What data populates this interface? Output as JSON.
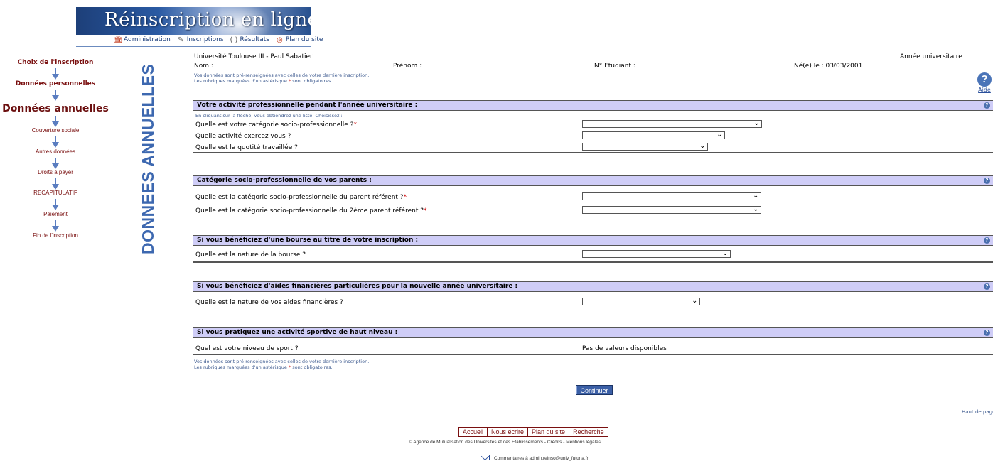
{
  "banner": {
    "title": "Réinscription en ligne"
  },
  "topnav": {
    "items": [
      {
        "label": "Administration",
        "icon": "bank-icon"
      },
      {
        "label": "Inscriptions",
        "icon": "pen-icon"
      },
      {
        "label": "Résultats",
        "icon": "brackets-icon"
      },
      {
        "label": "Plan du site",
        "icon": "sitemap-icon"
      }
    ]
  },
  "steps": [
    "Choix de l'inscription",
    "Données personnelles",
    "Données annuelles",
    "Couverture sociale",
    "Autres données",
    "Droits à payer",
    "RECAPITULATIF",
    "Paiement",
    "Fin de l'inscription"
  ],
  "vertical_title": "DONNEES ANNUELLES",
  "header": {
    "university": "Université Toulouse III - Paul Sabatier",
    "nom": "Nom :",
    "prenom": "Prénom :",
    "etudiant": "N° Etudiant :",
    "naissance": "Né(e) le : 03/03/2001",
    "annee": "Année universitaire",
    "note_line1": "Vos données sont pré-renseignées avec celles de votre dernière inscription.",
    "note_line2_a": "Les rubriques marquées d'un astérisque",
    "note_line2_star": "*",
    "note_line2_b": "sont obligatoires.",
    "help_label": "Aide",
    "help_icon": "?"
  },
  "sections": {
    "pro": {
      "title": "Votre activité professionnelle pendant l'année universitaire :",
      "hint": "En cliquant sur la flèche, vous obtiendrez une liste. Choisissez :",
      "q1": "Quelle est votre catégorie socio-professionnelle ?",
      "q2": "Quelle activité exercez vous ?",
      "q3": "Quelle est la quotité travaillée ?"
    },
    "parents": {
      "title": "Catégorie socio-professionnelle de vos parents :",
      "q1": "Quelle est la catégorie socio-professionnelle du parent référent ?",
      "q2": "Quelle est la catégorie socio-professionnelle du 2ème parent référent ?"
    },
    "bourse": {
      "title": "Si vous bénéficiez d'une bourse au titre de votre inscription :",
      "q1": "Quelle est la nature de la bourse ?"
    },
    "aides": {
      "title": "Si vous bénéficiez d'aides financières particulières pour la nouvelle année universitaire :",
      "q1": "Quelle est la nature de vos aides financières ?"
    },
    "sport": {
      "title": "Si vous pratiquez une activité sportive de haut niveau :",
      "q1": "Quel est votre niveau de sport ?",
      "value": "Pas de valeurs disponibles"
    },
    "required_star": "*",
    "help_icon": "?"
  },
  "continue_label": "Continuer",
  "top_link": "Haut de page",
  "footer": {
    "links": [
      "Accueil",
      "Nous écrire",
      "Plan du site",
      "Recherche"
    ],
    "copyright": "© Agence de Mutualisation des Universités et des Etablissements - Crédits - Mentions légales",
    "comments": "Commentaires à admin.reinso@univ_futuna.fr"
  },
  "colors": {
    "section_header": "#cfcdf7",
    "steps_text": "#7a1010",
    "vertical_title": "#3d68b0",
    "button": "#3b5fa6"
  }
}
